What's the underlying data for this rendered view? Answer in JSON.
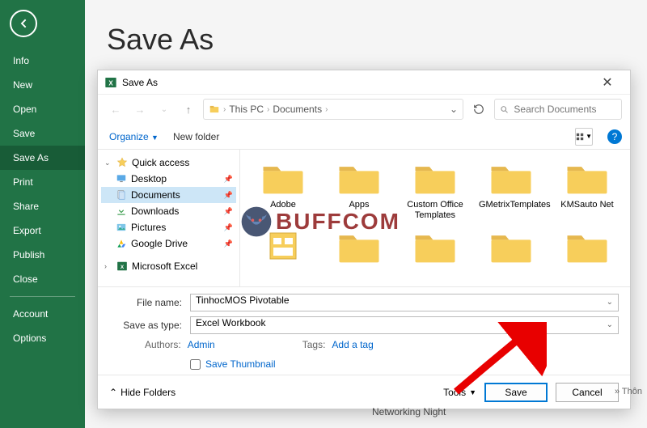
{
  "sidebar": {
    "items": [
      {
        "label": "Info"
      },
      {
        "label": "New"
      },
      {
        "label": "Open"
      },
      {
        "label": "Save"
      },
      {
        "label": "Save As",
        "selected": true
      },
      {
        "label": "Print"
      },
      {
        "label": "Share"
      },
      {
        "label": "Export"
      },
      {
        "label": "Publish"
      },
      {
        "label": "Close"
      }
    ],
    "bottom": [
      {
        "label": "Account"
      },
      {
        "label": "Options"
      }
    ]
  },
  "page_title": "Save As",
  "dialog": {
    "title": "Save As",
    "breadcrumb": [
      "This PC",
      "Documents"
    ],
    "search_placeholder": "Search Documents",
    "toolbar": {
      "organize": "Organize",
      "new_folder": "New folder"
    },
    "nav_tree": {
      "quick_access": "Quick access",
      "items": [
        {
          "label": "Desktop",
          "icon": "desktop"
        },
        {
          "label": "Documents",
          "icon": "documents",
          "selected": true
        },
        {
          "label": "Downloads",
          "icon": "downloads"
        },
        {
          "label": "Pictures",
          "icon": "pictures"
        },
        {
          "label": "Google Drive",
          "icon": "gdrive"
        }
      ],
      "excel": "Microsoft Excel"
    },
    "folders": [
      {
        "label": "Adobe"
      },
      {
        "label": "Apps"
      },
      {
        "label": "Custom Office Templates"
      },
      {
        "label": "GMetrixTemplates"
      },
      {
        "label": "KMSauto Net"
      }
    ],
    "fields": {
      "file_name_label": "File name:",
      "file_name_value": "TinhocMOS Pivotable",
      "save_type_label": "Save as type:",
      "save_type_value": "Excel Workbook",
      "authors_label": "Authors:",
      "authors_value": "Admin",
      "tags_label": "Tags:",
      "tags_value": "Add a tag",
      "save_thumbnail": "Save Thumbnail"
    },
    "footer": {
      "hide_folders": "Hide Folders",
      "tools": "Tools",
      "save": "Save",
      "cancel": "Cancel"
    }
  },
  "watermark": "BUFFCOM",
  "background": {
    "item": "Networking Night",
    "crumb": "» Thôn"
  }
}
